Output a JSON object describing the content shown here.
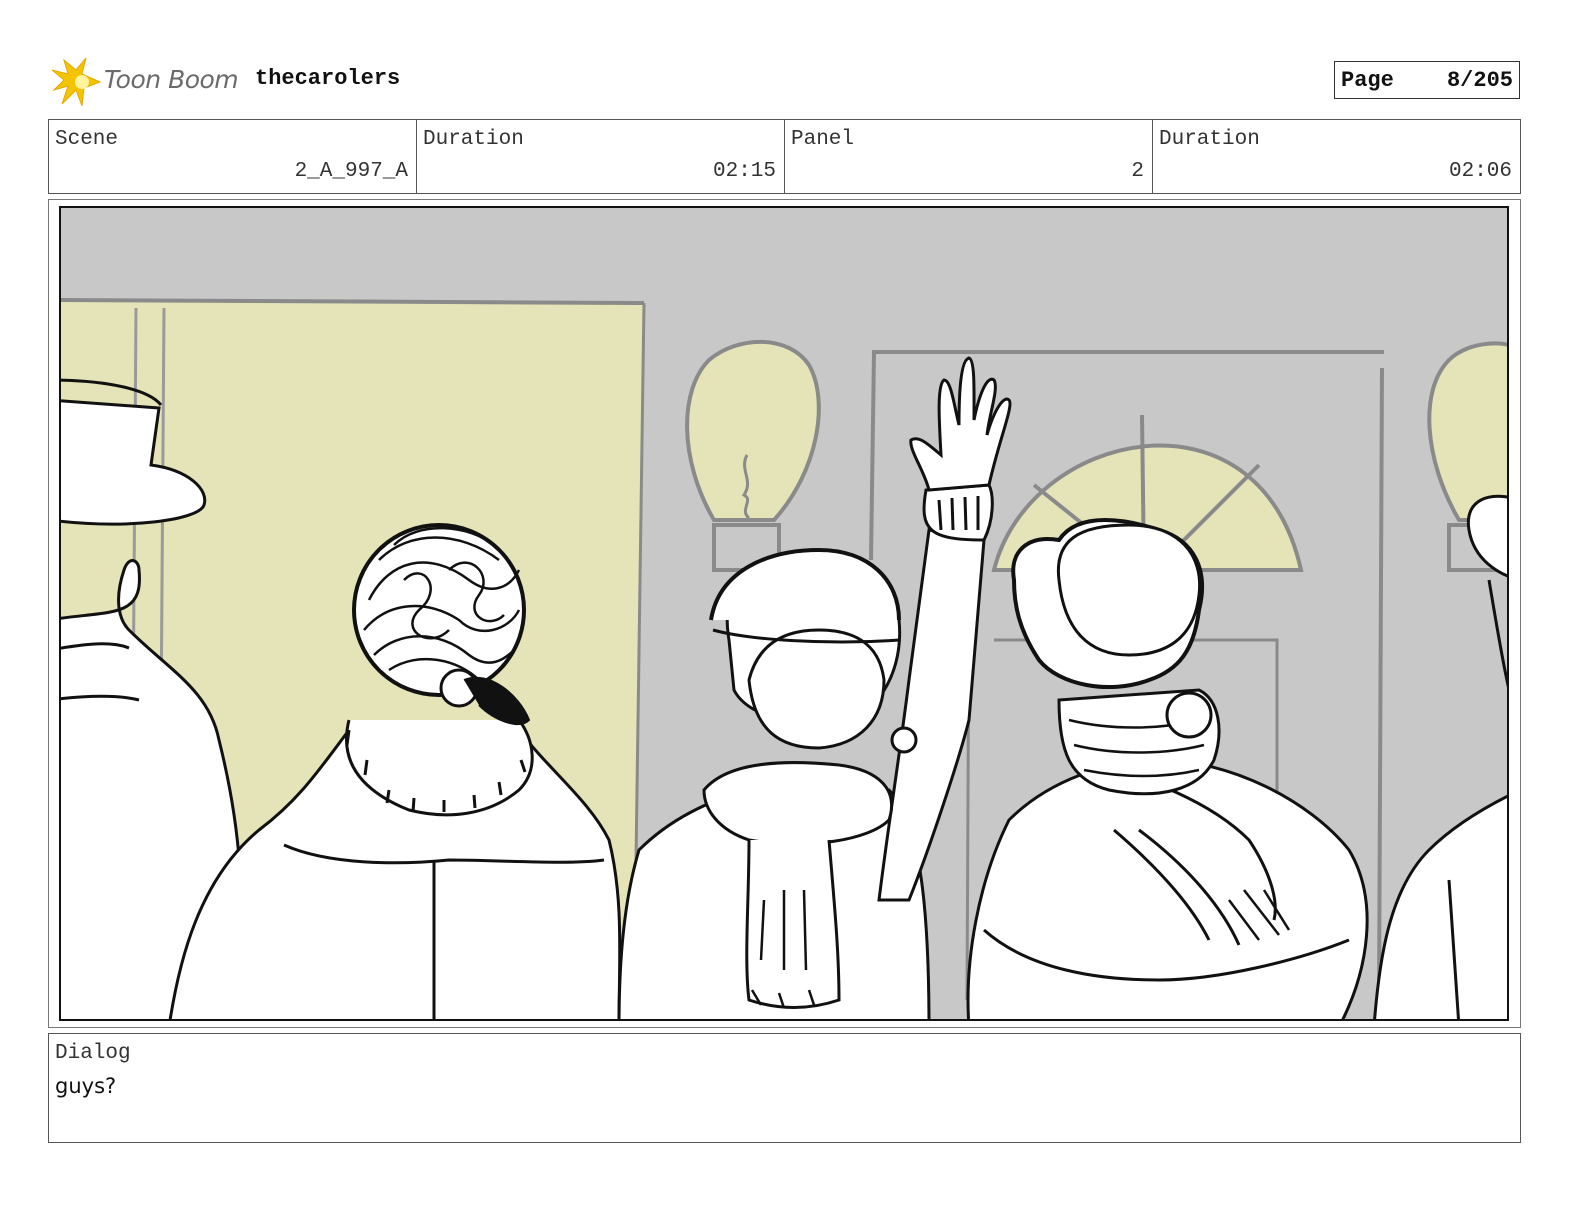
{
  "header": {
    "logo_text": "Toon Boom",
    "project_title": "thecarolers",
    "page_label": "Page",
    "page_value": "8/205"
  },
  "info": {
    "scene_label": "Scene",
    "scene_value": "2_A_997_A",
    "scene_duration_label": "Duration",
    "scene_duration_value": "02:15",
    "panel_label": "Panel",
    "panel_value": "2",
    "panel_duration_label": "Duration",
    "panel_duration_value": "02:06"
  },
  "dialog": {
    "label": "Dialog",
    "text": "guys?"
  },
  "colors": {
    "logo_yellow": "#f5c400",
    "wall_gray": "#c8c8c8",
    "light_yellow": "#e4e4b8"
  },
  "icons": {
    "logo": "toon-boom-star-icon"
  }
}
